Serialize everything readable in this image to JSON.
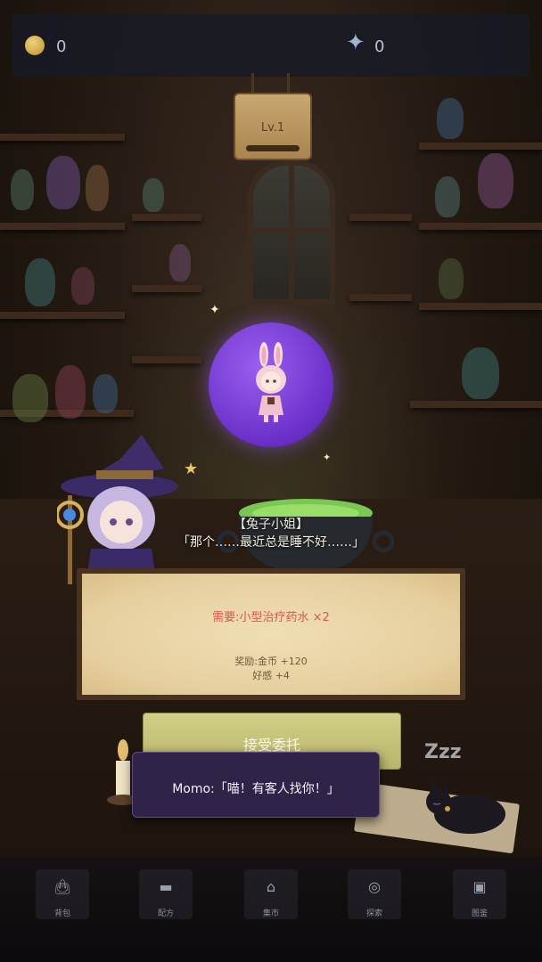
{
  "resources": {
    "coins": "0",
    "gems": "0"
  },
  "level": {
    "label": "Lv.1",
    "progress": 0
  },
  "customer": {
    "name": "【兔子小姐】",
    "line": "「那个……最近总是睡不好……」"
  },
  "request": {
    "need": "需要:小型治疗药水 ×2",
    "reward_coins": "奖励:金币 +120",
    "reward_affection": "好感 +4"
  },
  "accept_button": {
    "label": "接受委托"
  },
  "sleep_text": "Zzz",
  "toast": {
    "text": "Momo:「喵！有客人找你！」"
  },
  "nav": {
    "items": [
      {
        "label": "背包",
        "icon": "bag-icon"
      },
      {
        "label": "配方",
        "icon": "book-icon"
      },
      {
        "label": "集市",
        "icon": "market-icon"
      },
      {
        "label": "探索",
        "icon": "compass-icon"
      },
      {
        "label": "图鉴",
        "icon": "catalog-icon"
      }
    ]
  },
  "colors": {
    "bubble": "#6a2fc7",
    "accept": "#c6c37a",
    "toast": "#2f2447",
    "need": "#d9574e"
  }
}
